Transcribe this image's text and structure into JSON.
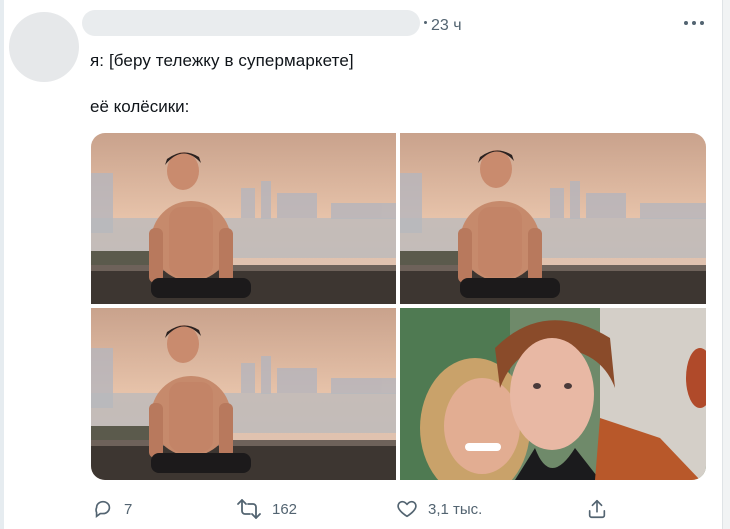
{
  "tweet": {
    "time": "23 ч",
    "line1": "я: [беру тележку в супермаркете]",
    "line2": "её колёсики:",
    "reply_count": "7",
    "retweet_count": "162",
    "like_count": "3,1 тыс."
  },
  "icons": {
    "more": "more-dots-icon",
    "reply": "reply-bubble-icon",
    "retweet": "retweet-arrows-icon",
    "like": "heart-icon",
    "share": "share-upload-icon"
  },
  "colors": {
    "muted": "#536471",
    "text": "#0f1419",
    "sky": "#e8c4a8"
  }
}
